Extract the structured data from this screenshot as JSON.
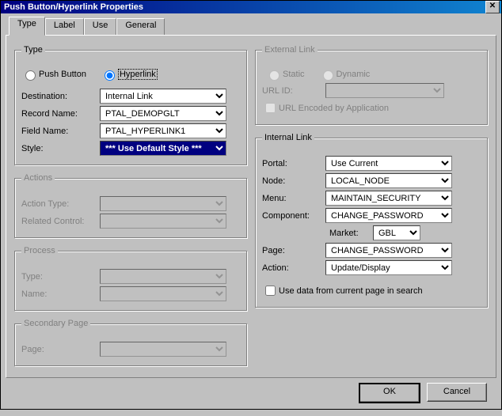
{
  "window": {
    "title": "Push Button/Hyperlink Properties"
  },
  "tabs": {
    "type": "Type",
    "label": "Label",
    "use": "Use",
    "general": "General"
  },
  "typeGroup": {
    "legend": "Type",
    "pushButton": "Push Button",
    "hyperlink": "Hyperlink",
    "destinationLabel": "Destination:",
    "destinationValue": "Internal Link",
    "recordNameLabel": "Record Name:",
    "recordNameValue": "PTAL_DEMOPGLT",
    "fieldNameLabel": "Field Name:",
    "fieldNameValue": "PTAL_HYPERLINK1",
    "styleLabel": "Style:",
    "styleValue": "*** Use Default Style ***"
  },
  "actionsGroup": {
    "legend": "Actions",
    "actionTypeLabel": "Action Type:",
    "relatedControlLabel": "Related Control:"
  },
  "processGroup": {
    "legend": "Process",
    "typeLabel": "Type:",
    "nameLabel": "Name:"
  },
  "secondaryPageGroup": {
    "legend": "Secondary Page",
    "pageLabel": "Page:"
  },
  "externalLinkGroup": {
    "legend": "External Link",
    "static": "Static",
    "dynamic": "Dynamic",
    "urlIdLabel": "URL ID:",
    "urlEncodedLabel": "URL Encoded by Application"
  },
  "internalLinkGroup": {
    "legend": "Internal Link",
    "portalLabel": "Portal:",
    "portalValue": "Use Current",
    "nodeLabel": "Node:",
    "nodeValue": "LOCAL_NODE",
    "menuLabel": "Menu:",
    "menuValue": "MAINTAIN_SECURITY",
    "componentLabel": "Component:",
    "componentValue": "CHANGE_PASSWORD",
    "marketLabel": "Market:",
    "marketValue": "GBL",
    "pageLabel": "Page:",
    "pageValue": "CHANGE_PASSWORD",
    "actionLabel": "Action:",
    "actionValue": "Update/Display",
    "useDataLabel": "Use data from current page in search"
  },
  "buttons": {
    "ok": "OK",
    "cancel": "Cancel"
  }
}
